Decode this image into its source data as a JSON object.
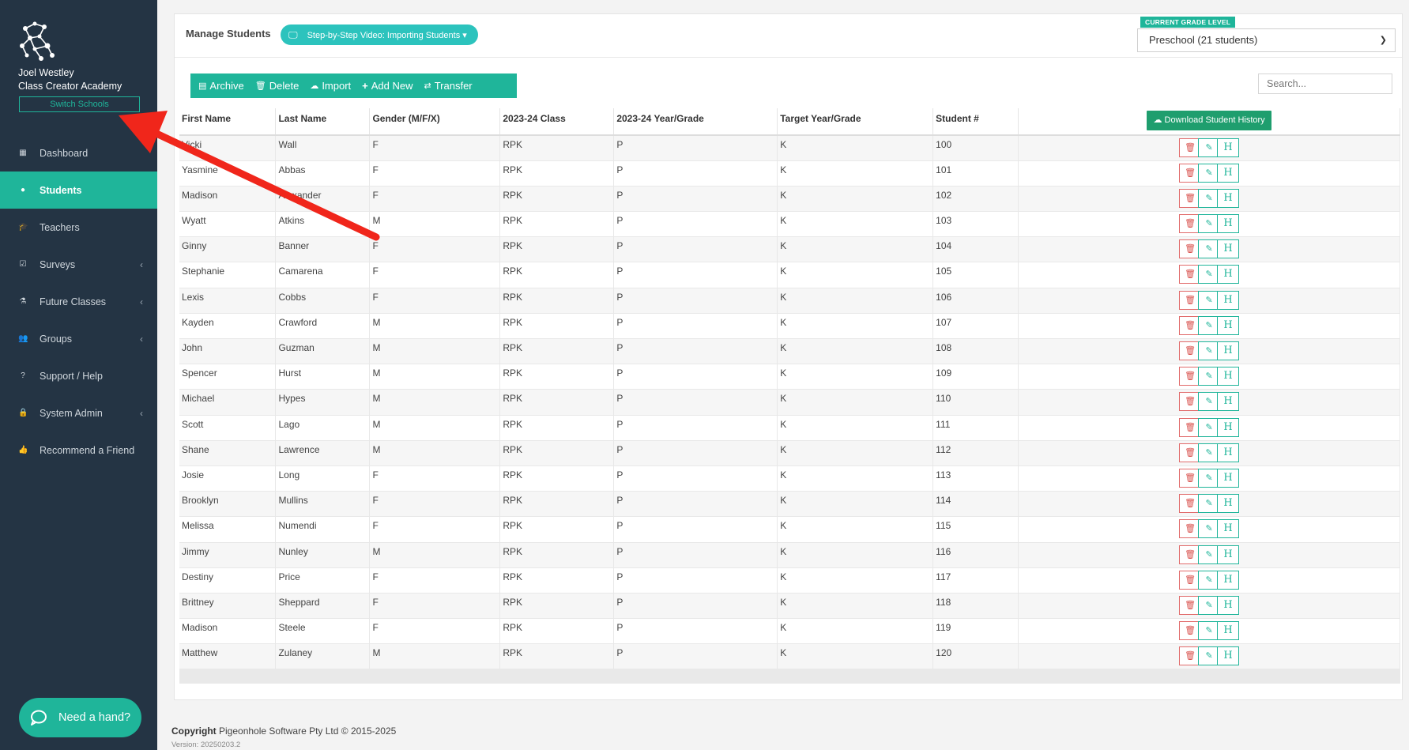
{
  "user": {
    "name": "Joel Westley",
    "school": "Class Creator Academy",
    "switch_label": "Switch Schools"
  },
  "nav": [
    {
      "label": "Dashboard",
      "icon": "dashboard-icon",
      "glyph": "▦",
      "active": false,
      "chevron": false
    },
    {
      "label": "Students",
      "icon": "user-icon",
      "glyph": "●",
      "active": true,
      "chevron": false
    },
    {
      "label": "Teachers",
      "icon": "graduation-cap-icon",
      "glyph": "🎓",
      "active": false,
      "chevron": false
    },
    {
      "label": "Surveys",
      "icon": "checkbox-icon",
      "glyph": "☑",
      "active": false,
      "chevron": true
    },
    {
      "label": "Future Classes",
      "icon": "flask-icon",
      "glyph": "⚗",
      "active": false,
      "chevron": true
    },
    {
      "label": "Groups",
      "icon": "users-icon",
      "glyph": "👥",
      "active": false,
      "chevron": true
    },
    {
      "label": "Support / Help",
      "icon": "question-icon",
      "glyph": "?",
      "active": false,
      "chevron": false
    },
    {
      "label": "System Admin",
      "icon": "lock-icon",
      "glyph": "🔒",
      "active": false,
      "chevron": true
    },
    {
      "label": "Recommend a Friend",
      "icon": "thumbs-up-icon",
      "glyph": "👍",
      "active": false,
      "chevron": false
    }
  ],
  "help_label": "Need a hand?",
  "header": {
    "title": "Manage Students",
    "video_label": "Step-by-Step Video: Importing Students ▾",
    "grade_level_label": "CURRENT GRADE LEVEL",
    "grade_selected": "Preschool (21 students)"
  },
  "toolbar": {
    "archive": "Archive",
    "delete": "Delete",
    "import": "Import",
    "add_new": "Add New",
    "transfer": "Transfer"
  },
  "search": {
    "placeholder": "Search..."
  },
  "table": {
    "columns": [
      "First Name",
      "Last Name",
      "Gender (M/F/X)",
      "2023-24 Class",
      "2023-24 Year/Grade",
      "Target Year/Grade",
      "Student #"
    ],
    "download_label": "Download Student History",
    "rows": [
      [
        "Vicki",
        "Wall",
        "F",
        "RPK",
        "P",
        "K",
        "100"
      ],
      [
        "Yasmine",
        "Abbas",
        "F",
        "RPK",
        "P",
        "K",
        "101"
      ],
      [
        "Madison",
        "Alexander",
        "F",
        "RPK",
        "P",
        "K",
        "102"
      ],
      [
        "Wyatt",
        "Atkins",
        "M",
        "RPK",
        "P",
        "K",
        "103"
      ],
      [
        "Ginny",
        "Banner",
        "F",
        "RPK",
        "P",
        "K",
        "104"
      ],
      [
        "Stephanie",
        "Camarena",
        "F",
        "RPK",
        "P",
        "K",
        "105"
      ],
      [
        "Lexis",
        "Cobbs",
        "F",
        "RPK",
        "P",
        "K",
        "106"
      ],
      [
        "Kayden",
        "Crawford",
        "M",
        "RPK",
        "P",
        "K",
        "107"
      ],
      [
        "John",
        "Guzman",
        "M",
        "RPK",
        "P",
        "K",
        "108"
      ],
      [
        "Spencer",
        "Hurst",
        "M",
        "RPK",
        "P",
        "K",
        "109"
      ],
      [
        "Michael",
        "Hypes",
        "M",
        "RPK",
        "P",
        "K",
        "110"
      ],
      [
        "Scott",
        "Lago",
        "M",
        "RPK",
        "P",
        "K",
        "111"
      ],
      [
        "Shane",
        "Lawrence",
        "M",
        "RPK",
        "P",
        "K",
        "112"
      ],
      [
        "Josie",
        "Long",
        "F",
        "RPK",
        "P",
        "K",
        "113"
      ],
      [
        "Brooklyn",
        "Mullins",
        "F",
        "RPK",
        "P",
        "K",
        "114"
      ],
      [
        "Melissa",
        "Numendi",
        "F",
        "RPK",
        "P",
        "K",
        "115"
      ],
      [
        "Jimmy",
        "Nunley",
        "M",
        "RPK",
        "P",
        "K",
        "116"
      ],
      [
        "Destiny",
        "Price",
        "F",
        "RPK",
        "P",
        "K",
        "117"
      ],
      [
        "Brittney",
        "Sheppard",
        "F",
        "RPK",
        "P",
        "K",
        "118"
      ],
      [
        "Madison",
        "Steele",
        "F",
        "RPK",
        "P",
        "K",
        "119"
      ],
      [
        "Matthew",
        "Zulaney",
        "M",
        "RPK",
        "P",
        "K",
        "120"
      ]
    ],
    "row_actions": {
      "delete_glyph": "🗑",
      "edit_glyph": "✎",
      "history_glyph": "H"
    }
  },
  "footer": {
    "copyright_label": "Copyright",
    "copyright_text": " Pigeonhole Software Pty Ltd © 2015-2025",
    "version": "Version: 20250203.2"
  },
  "colors": {
    "sidebar": "#243444",
    "accent": "#1fb59a",
    "video_button": "#2cc3bd",
    "annotation_arrow": "#f0261b"
  }
}
